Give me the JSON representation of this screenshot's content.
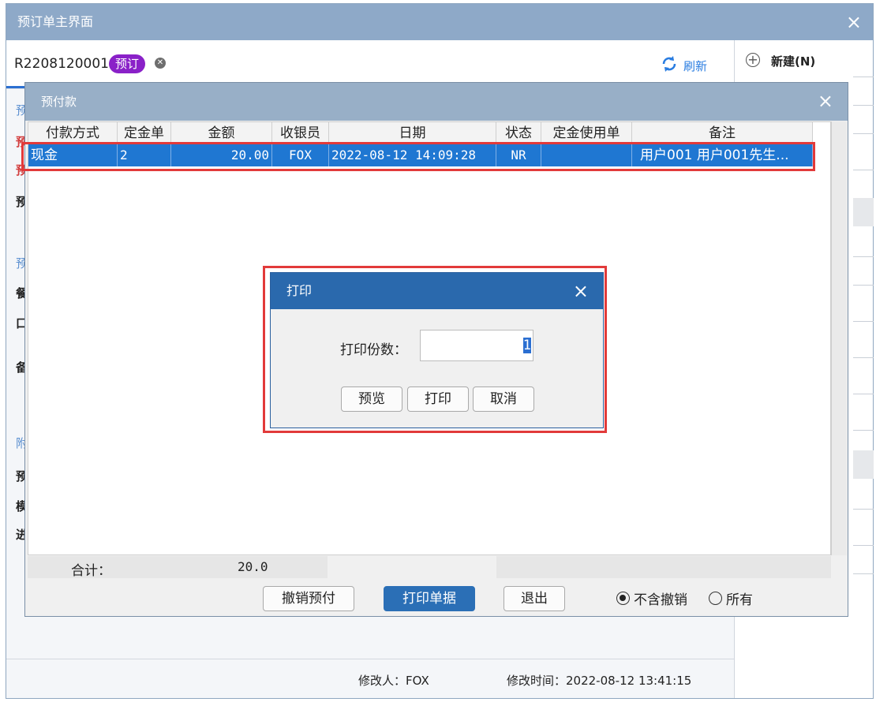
{
  "main": {
    "title": "预订单主界面",
    "close_glyph": "×",
    "order_no": "R2208120001",
    "status_badge": "预订",
    "refresh_label": "刷新",
    "new_label": "新建(N)",
    "left_chars": [
      "预",
      "预",
      "预",
      "预",
      "预",
      "餐",
      "口",
      "备",
      "附",
      "预",
      "模",
      "进"
    ],
    "modifier": "修改人：FOX",
    "modified_time": "修改时间：2022-08-12 13:41:15"
  },
  "deposit_dialog": {
    "title": "预付款",
    "close_glyph": "×",
    "columns": [
      "付款方式",
      "定金单号",
      "金额",
      "收银员",
      "日期",
      "状态",
      "定金使用单",
      "备注"
    ],
    "rows": [
      [
        "现金",
        "2",
        "20.00",
        "FOX",
        "2022-08-12 14:09:28",
        "NR",
        "",
        "用户001 用户001先生..."
      ]
    ],
    "total_label": "合计：",
    "total_value": "20.0",
    "buttons": {
      "cancel_prepay": "撤销预付",
      "print_receipt": "打印单据",
      "exit": "退出"
    },
    "filter": {
      "options": [
        "不含撤销",
        "所有"
      ],
      "selected": "不含撤销"
    }
  },
  "print_dialog": {
    "title": "打印",
    "close_glyph": "×",
    "copies_label": "打印份数：",
    "copies_value": "1",
    "buttons": {
      "preview": "预览",
      "print": "打印",
      "cancel": "取消"
    }
  },
  "colors": {
    "title_bar": "#8ea9c8",
    "selection": "#1f77d2",
    "highlight_border": "#e23a3a",
    "badge": "#8a21c8",
    "primary_button": "#2b6fb6"
  }
}
